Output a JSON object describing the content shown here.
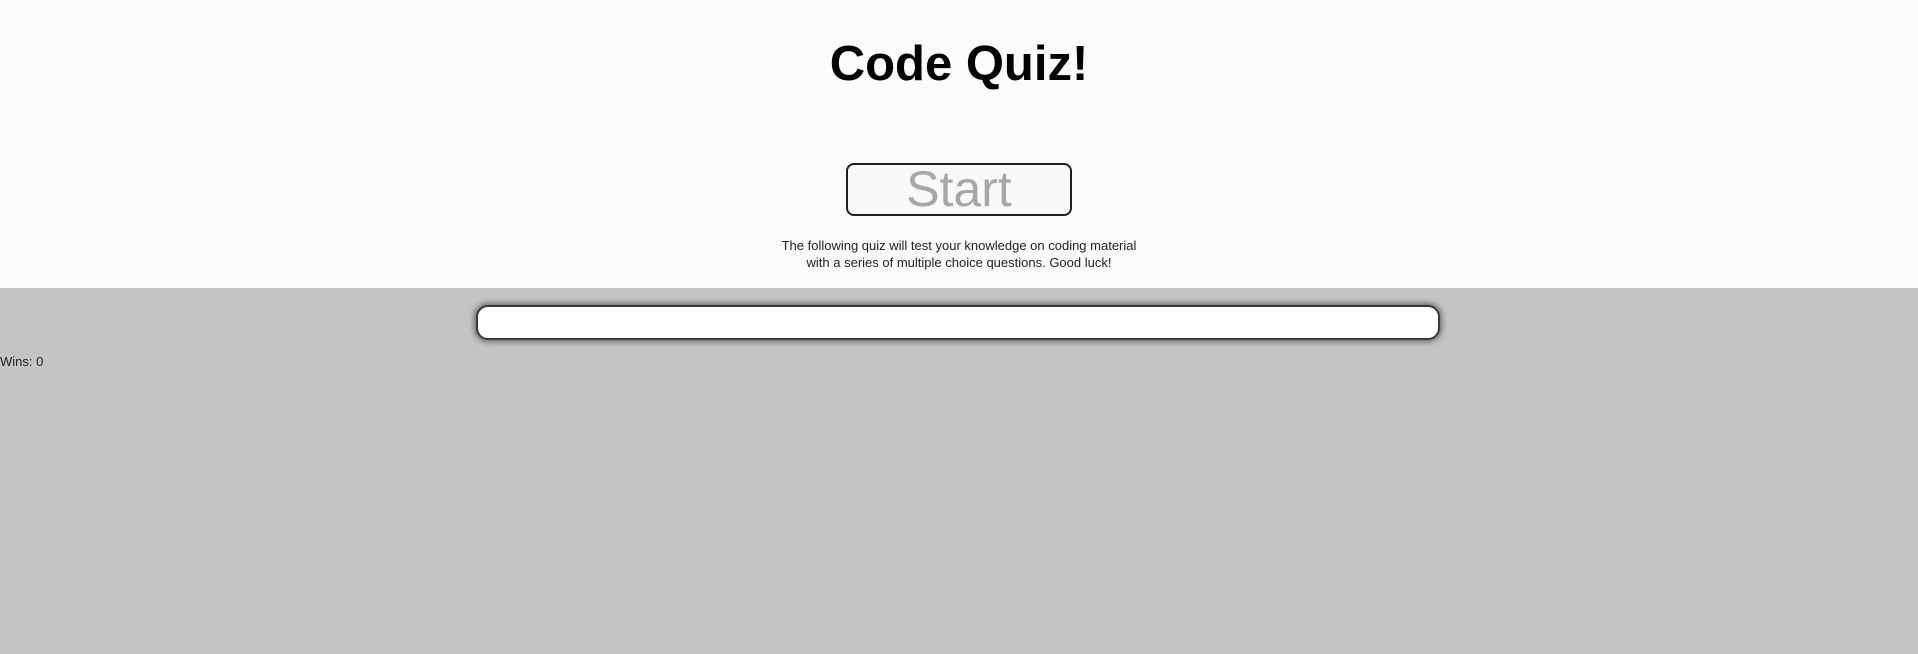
{
  "header": {
    "title": "Code Quiz!",
    "start_label": "Start",
    "description_line1": "The following quiz will test your knowledge on coding material",
    "description_line2": "with a series of multiple choice questions. Good luck!"
  },
  "main": {
    "question_text": "",
    "wins_label": "Wins: 0"
  },
  "colors": {
    "header_background": "#fbfbfb",
    "main_background": "#c4c4c4",
    "start_text": "#a7a7a7"
  }
}
